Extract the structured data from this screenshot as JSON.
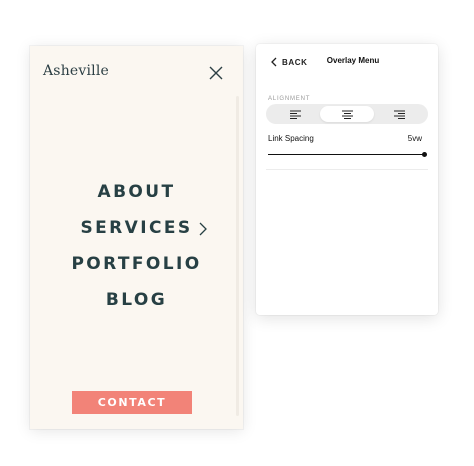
{
  "preview": {
    "logo": "Asheville",
    "menu_items": [
      {
        "label": "ABOUT",
        "has_submenu": false
      },
      {
        "label": "SERVICES",
        "has_submenu": true
      },
      {
        "label": "PORTFOLIO",
        "has_submenu": false
      },
      {
        "label": "BLOG",
        "has_submenu": false
      }
    ],
    "contact_label": "CONTACT",
    "colors": {
      "background": "#fbf7f1",
      "text": "#274044",
      "button": "#f28378"
    }
  },
  "panel": {
    "back_label": "BACK",
    "title": "Overlay Menu",
    "alignment_label": "ALIGNMENT",
    "alignment_options": [
      "left",
      "center",
      "right"
    ],
    "alignment_selected": "center",
    "link_spacing_label": "Link Spacing",
    "link_spacing_value": "5vw",
    "link_spacing_fraction": 1.0
  }
}
